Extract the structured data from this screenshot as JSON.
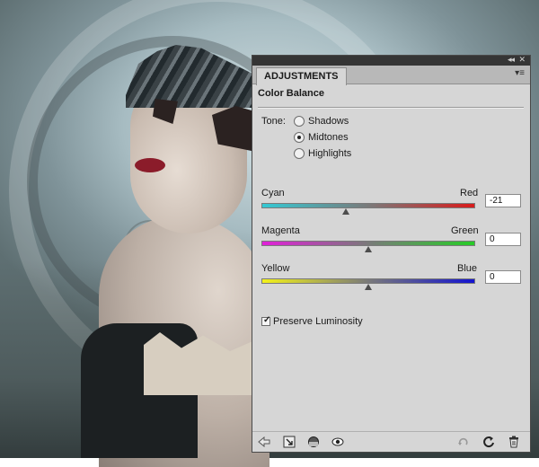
{
  "panel": {
    "tab_label": "ADJUSTMENTS",
    "title": "Color Balance",
    "tone_label": "Tone:",
    "tones": [
      {
        "label": "Shadows",
        "selected": false
      },
      {
        "label": "Midtones",
        "selected": true
      },
      {
        "label": "Highlights",
        "selected": false
      }
    ],
    "sliders": [
      {
        "left_label": "Cyan",
        "right_label": "Red",
        "value": "-21",
        "level": -21,
        "gradient": [
          "#33c9d4",
          "#d91b1b"
        ]
      },
      {
        "left_label": "Magenta",
        "right_label": "Green",
        "value": "0",
        "level": 0,
        "gradient": [
          "#e020d8",
          "#27cc27"
        ]
      },
      {
        "left_label": "Yellow",
        "right_label": "Blue",
        "value": "0",
        "level": 0,
        "gradient": [
          "#f3f21a",
          "#1414d0"
        ]
      }
    ],
    "preserve_luminosity": {
      "label": "Preserve Luminosity",
      "checked": true
    },
    "footer_icons": [
      "back-arrow-icon",
      "clip-to-layer-icon",
      "mask-visibility-icon",
      "view-previous-icon",
      "toggle-visibility-icon",
      "reset-icon",
      "trash-icon"
    ]
  }
}
